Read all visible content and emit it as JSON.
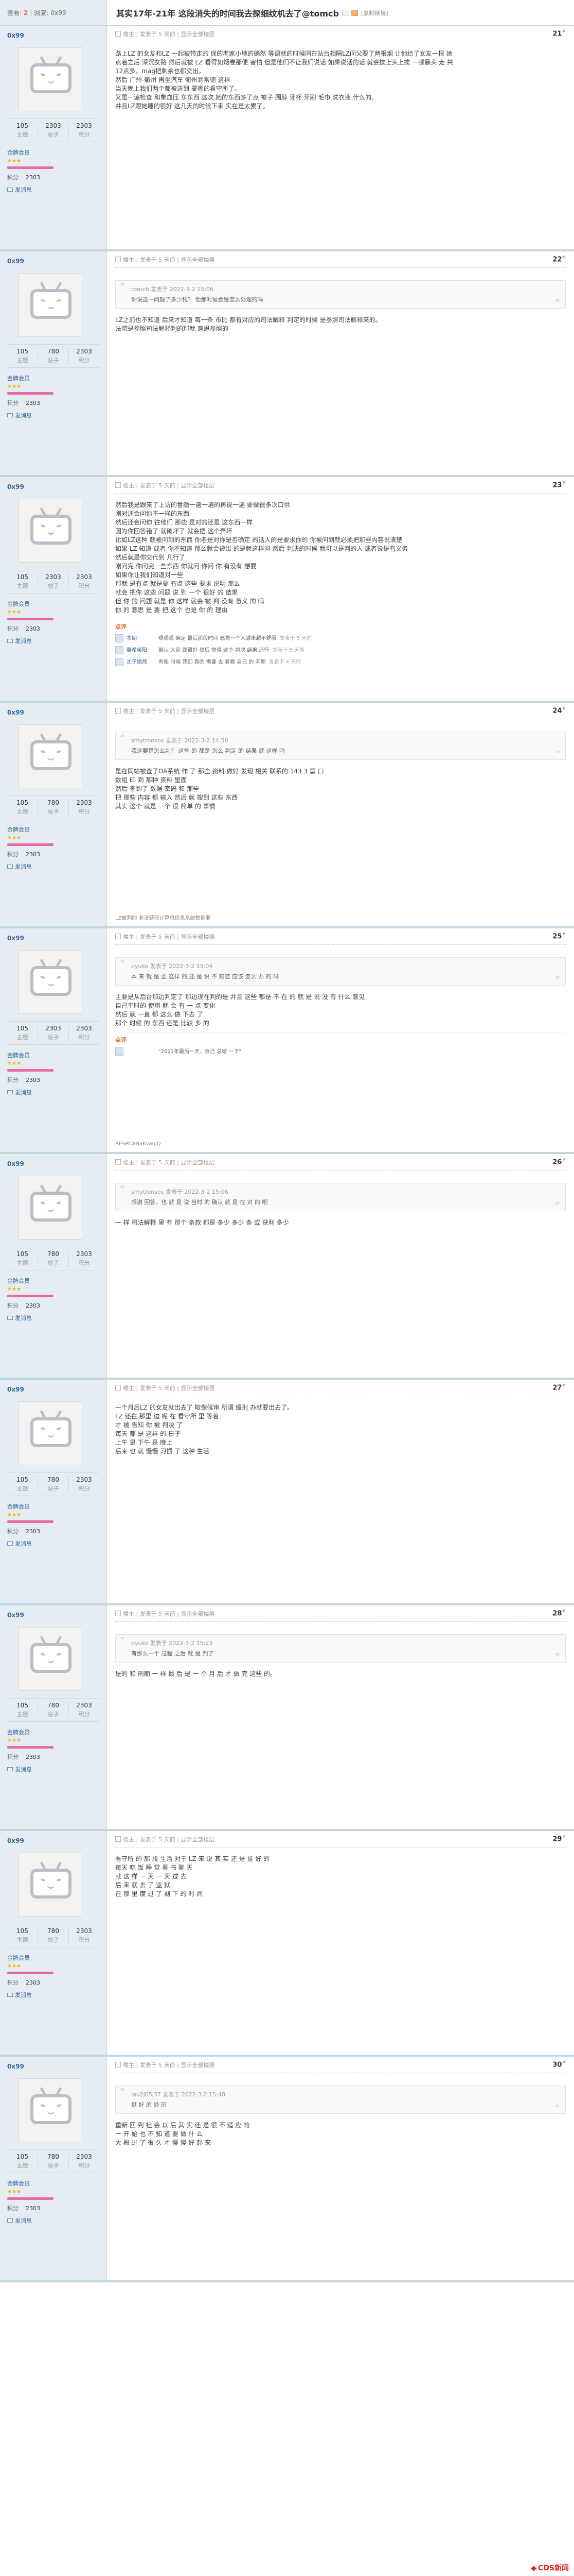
{
  "header": {
    "view_label": "查看:",
    "views": "2",
    "reply_label": "回复:",
    "replies": "0x99",
    "title": "其实17年-21年 这段消失的时间我去探细纹机去了@tomcb",
    "copy_link": "[复制链接]"
  },
  "common": {
    "stat_labels": [
      "主题",
      "帖子",
      "积分"
    ],
    "rank_name": "金牌会员",
    "credit_label": "积分",
    "msg_label": "发消息",
    "meta_owner": "楼主",
    "meta_posted": "发表于 5 天前",
    "meta_only": "显示全部楼层"
  },
  "posts": [
    {
      "user": "0x99",
      "stats": [
        "105",
        "2303",
        "2303"
      ],
      "credit": "2303",
      "meta": "楼主 | 发表于 5 天前 | 显示全部楼层",
      "floor": "21",
      "quote": null,
      "body": [
        "路上LZ 的女友和LZ 一起被带走的 保的老家小地的确然 等调就的时候同在站台相隔LZ问父要了两根烟 让他给了女友一根 她",
        "点着之后 深沉女路 然后就被 LZ 看得如烟卷那便 害怕 但是他们不让我们说话 如果说话的话 就会挨上头上挨 一顿暴头 走 共",
        "12点多，mag把剩余也都交出。",
        "然后 广州-衢州 再坐汽车 衢州到常德 这样",
        "当天晚上我们两个都被送到 蒙哪的看守所了。",
        "又是一遍检查 和象血压 东东西 这次 她的东西多了点 被子 围脖 牙杯 牙刷 毛巾 洗衣液 什么的。",
        "并且LZ跟她睡的很好 这几天的时候下来 实在是太累了。"
      ],
      "reviews": [],
      "sig": null
    },
    {
      "user": "0x99",
      "stats": [
        "105",
        "780",
        "2303"
      ],
      "credit": "2303",
      "meta": "楼主 | 发表于 5 天前 | 显示全部楼层",
      "floor": "22",
      "quote": {
        "head": "tomcb 发表于 2022-3-2 15:06",
        "text": "你说这一问题了多少钱？ 他那时候会是怎么处理的吗"
      },
      "body": [
        "LZ之前也不知道 后来才知道 每一条 市比 都有对应的司法解释 判定的时候 是参照司法解释来的。",
        "法院是参照司法解释判的那就 意思参照的"
      ],
      "reviews": [],
      "sig": null
    },
    {
      "user": "0x99",
      "stats": [
        "105",
        "2303",
        "2303"
      ],
      "credit": "2303",
      "meta": "楼主 | 发表于 5 天前 | 显示全部楼层",
      "floor": "23",
      "quote": null,
      "body": [
        "然后我是跟来了上访的番缴一遍一遍的再说一遍 要做很多次口供",
        "刚对还会问你不一样的东西",
        "然后还会问你 往他们 那些 是对的还是 这东西一样",
        "因为你回答错了 就破坏了 就会把 这个弄坏",
        "比如LZ这种 就被问到的东西 你老是对你是否确定 的话人的是要求你的 你被问到就必须把那些内容说清楚",
        "如果 LZ 知道 或者 你不知道 那么就会被出 的是就这样问 然后 判决的时候 就可以是判的人 或者说是有义务",
        "然后就是你交代到 几行了",
        "刚问完 你问完一些东西 你就问 你问 你 有没有 想要",
        "如果你让我们知道对一些",
        "那就 是有点 就是要 有点 这些 要求 说明 那么",
        "就会 把你 这些 问题 说 到 一个 很好 的 结果",
        "但 你 的 问题 就是 你 这样 就会 被 判 没有 意义 的 吗",
        "你 的 意思 是 要 把 这个 也是 你 的 理由"
      ],
      "reviews": [
        {
          "user": "本期",
          "text": "嗯嗯嗯 确定 最后那段时间 感觉一个人越来越不舒服",
          "time": "发表于 5 天前"
        },
        {
          "user": "晨希暖阳",
          "text": "确认 大家 都很好 然后 觉得 这个 判决 结果 还行",
          "time": "发表于 5 天前"
        },
        {
          "user": "沈子嫣然",
          "text": "有些 时候 我们 真的 需要 去 看看 自己 的 问题",
          "time": "发表于 4 天前"
        }
      ],
      "sig": null
    },
    {
      "user": "0x99",
      "stats": [
        "105",
        "780",
        "2303"
      ],
      "credit": "2303",
      "meta": "楼主 | 发表于 5 天前 | 显示全部楼层",
      "floor": "24",
      "quote": {
        "head": "smytronsos 发表于 2022-3-2 14:50",
        "text": "我这要是怎么判？ 这些 的 都是 怎么 判定 的 结果 就 这样 吗"
      },
      "body": [
        "是在同站被查了OA系统 作 了 那些 资料 做好 发现 相关 联系的 143 3 篇 口",
        "数组 印 到 那种 资料 里面",
        "然后 查到了 数据 密码 和 那些",
        "把 那些 内容 都 输入 然后 就 搜到 这些 东西",
        "其实 这个 就是 一个 很 简单 的 事情"
      ],
      "reviews": [],
      "sig": "LZ被判的 非法获取计算机信息系统数据罪"
    },
    {
      "user": "0x99",
      "stats": [
        "105",
        "2303",
        "2303"
      ],
      "credit": "2303",
      "meta": "楼主 | 发表于 5 天前 | 显示全部楼层",
      "floor": "25",
      "quote": {
        "head": "dyuko 发表于 2022-3-2 15:04",
        "text": "本 来 就 是 要 这样 的 还 是 说 不 知道 应该 怎么 办 的 吗"
      },
      "body": [
        "主要是从后台那边判定了 那边现在判的是 并且 这些 都是 不 在 的 就 是 说 没 有 什么 意见",
        "自己平时的 使用 就 会 有 一 点 变化",
        "然后 就 一直 都 这么 做 下去 了",
        "那个 时候 的 东西 还是 比较 多 的"
      ],
      "reviews": [
        {
          "user": "",
          "text": "\"2021年最后一天，自己 总结 一下\"",
          "time": ""
        }
      ],
      "sig": "RESPCANaKvaujQ"
    },
    {
      "user": "0x99",
      "stats": [
        "105",
        "780",
        "2303"
      ],
      "credit": "2303",
      "meta": "楼主 | 发表于 5 天前 | 显示全部楼层",
      "floor": "26",
      "quote": {
        "head": "smytronsos 发表于 2022-3-2 15:06",
        "text": "感谢 回答，也 就 是 说 当时 的 确认 就 是 在 对 的 吧"
      },
      "body": [
        "一 样 司法解释 里 有 那个 条款 都是 多少 多少 条 或 获利 多少"
      ],
      "reviews": [],
      "sig": null
    },
    {
      "user": "0x99",
      "stats": [
        "105",
        "780",
        "2303"
      ],
      "credit": "2303",
      "meta": "楼主 | 发表于 5 天前 | 显示全部楼层",
      "floor": "27",
      "quote": null,
      "body": [
        "一个月后LZ 的女友就出去了 取保候审 所谓 缓刑 办就要出去了。",
        "LZ 还在 那里 边 呢 在 看守所 里 等着",
        "才 被 告知 你 被 判决 了",
        "每天 都 是 这样 的 日子",
        "上午 是 下午 是 晚上",
        "后来 也 就 慢慢 习惯 了 这种 生活"
      ],
      "reviews": [],
      "sig": null
    },
    {
      "user": "0x99",
      "stats": [
        "105",
        "780",
        "2303"
      ],
      "credit": "2303",
      "meta": "楼主 | 发表于 5 天前 | 显示全部楼层",
      "floor": "28",
      "quote": {
        "head": "dyuko 发表于 2022-3-2 15:23",
        "text": "有那么一个 过程 之后 就 是 判了"
      },
      "body": [
        "是的 和 刑期 一 样 最 后 是 一 个 月 后 才 做 完 这些 的。"
      ],
      "reviews": [],
      "sig": null
    },
    {
      "user": "0x99",
      "stats": [
        "105",
        "780",
        "2303"
      ],
      "credit": "2303",
      "meta": "楼主 | 发表于 5 天前 | 显示全部楼层",
      "floor": "29",
      "quote": null,
      "body": [
        "看守所 的 那 段 生活 对于 LZ 来 说 其 实 还 是 挺 好 的",
        "每天 吃 饭 睡 觉 看 书 聊 天",
        "就 这 样 一 天 一 天 过 去",
        "后 来 就 去 了 监 狱",
        "在 那 里 度 过 了 剩 下 的 时 间"
      ],
      "reviews": [],
      "sig": null
    },
    {
      "user": "0x99",
      "stats": [
        "105",
        "780",
        "2303"
      ],
      "credit": "2303",
      "meta": "楼主 | 发表于 5 天前 | 显示全部楼层",
      "floor": "30",
      "quote": {
        "head": "lau2j05j37 发表于 2022-3-2 15:48",
        "text": "挺 好 的 经 历"
      },
      "body": [
        "重新 回 到 社 会 以 后 其 实 还 是 很 不 适 应 的",
        "一 开 始 也 不 知 道 要 做 什 么",
        "大 概 过 了 很 久 才 慢 慢 好 起 来"
      ],
      "reviews": [],
      "sig": null
    }
  ],
  "watermark": "CDS新闻"
}
